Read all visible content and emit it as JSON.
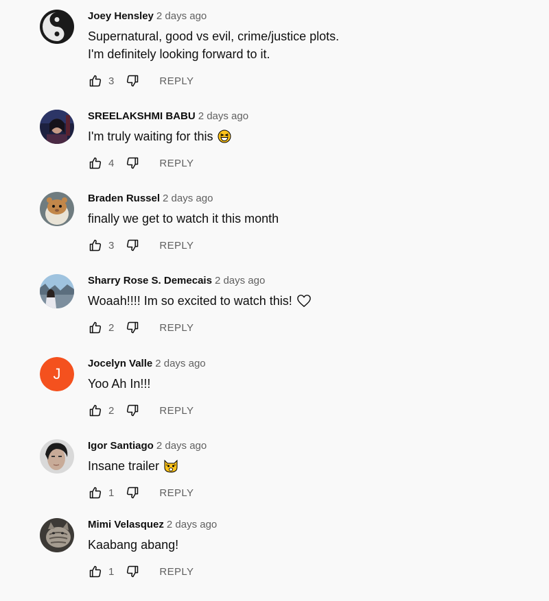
{
  "comments": [
    {
      "author": "Joey Hensley",
      "time": "2 days ago",
      "lines": [
        "Supernatural,  good vs evil, crime/justice plots.",
        "I'm definitely looking forward to it."
      ],
      "likes": "3",
      "reply_label": "REPLY",
      "avatar_icon": "yin-yang-avatar"
    },
    {
      "author": "SREELAKSHMI BABU",
      "time": "2 days ago",
      "lines": [
        "I'm truly waiting for this"
      ],
      "emoji": "grinning-squinting-face",
      "likes": "4",
      "reply_label": "REPLY",
      "avatar_icon": "dark-photo-avatar"
    },
    {
      "author": "Braden Russel",
      "time": "2 days ago",
      "lines": [
        "finally we get to watch it this month"
      ],
      "likes": "3",
      "reply_label": "REPLY",
      "avatar_icon": "hamster-avatar"
    },
    {
      "author": "Sharry Rose S. Demecais",
      "time": "2 days ago",
      "lines": [
        "Woaah!!!! Im so excited to watch this!"
      ],
      "emoji": "heart-outline",
      "likes": "2",
      "reply_label": "REPLY",
      "avatar_icon": "outdoor-photo-avatar"
    },
    {
      "author": "Jocelyn Valle",
      "time": "2 days ago",
      "lines": [
        "Yoo Ah In!!!"
      ],
      "likes": "2",
      "reply_label": "REPLY",
      "avatar_letter": "J",
      "avatar_color": "#f4511e"
    },
    {
      "author": "Igor Santiago",
      "time": "2 days ago",
      "lines": [
        "Insane trailer"
      ],
      "emoji": "weary-cat-face",
      "likes": "1",
      "reply_label": "REPLY",
      "avatar_icon": "face-photo-avatar"
    },
    {
      "author": "Mimi Velasquez",
      "time": "2 days ago",
      "lines": [
        "Kaabang abang!"
      ],
      "likes": "1",
      "reply_label": "REPLY",
      "avatar_icon": "cat-photo-avatar"
    }
  ]
}
